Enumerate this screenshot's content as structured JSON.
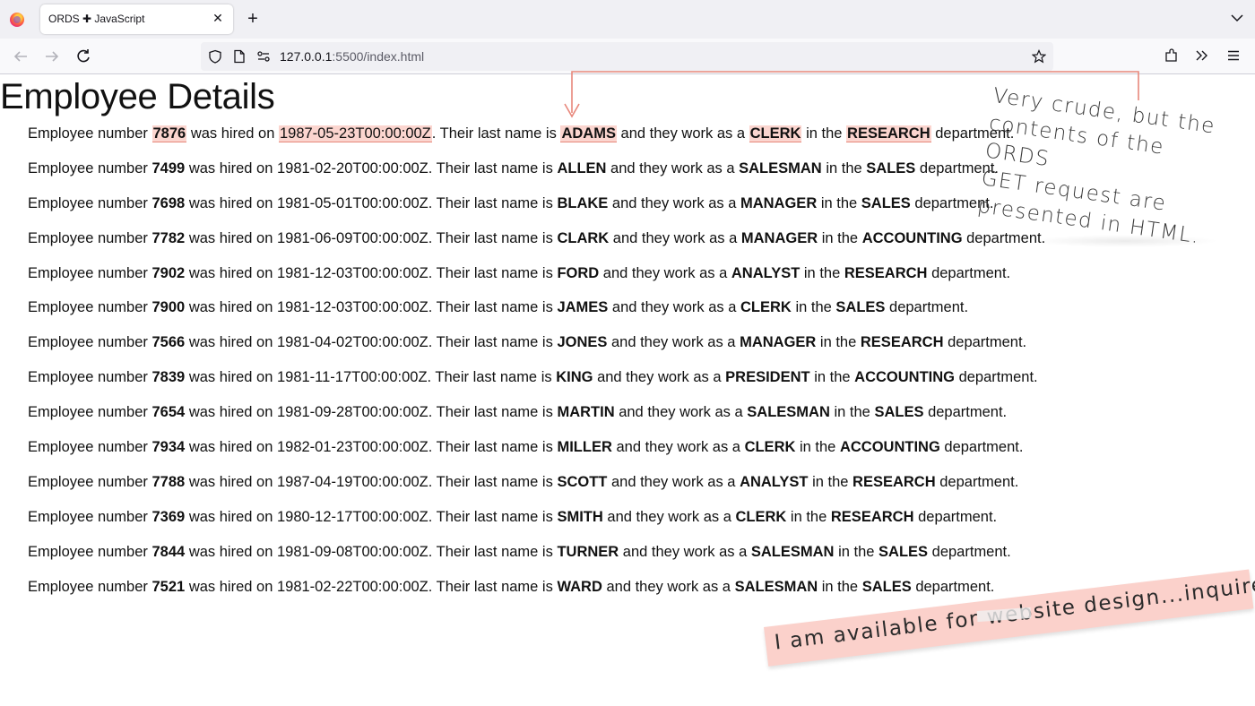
{
  "browser": {
    "tab": {
      "title": "ORDS ✚ JavaScript"
    },
    "url": {
      "host": "127.0.0.1",
      "path": ":5500/index.html"
    }
  },
  "colors": {
    "highlight": "#fbd5cf",
    "accent_line": "#e7867a",
    "sticky_note": "#fbd1cb"
  },
  "page": {
    "title": "Employee Details",
    "sentence": {
      "prefix": "Employee number",
      "hired": "was hired on",
      "lastname": ". Their last name is",
      "work": "and they work as a",
      "in_the": "in the",
      "suffix": "department."
    },
    "employees": [
      {
        "empno": "7876",
        "hiredate": "1987-05-23T00:00:00Z",
        "ename": "ADAMS",
        "job": "CLERK",
        "dept": "RESEARCH"
      },
      {
        "empno": "7499",
        "hiredate": "1981-02-20T00:00:00Z",
        "ename": "ALLEN",
        "job": "SALESMAN",
        "dept": "SALES"
      },
      {
        "empno": "7698",
        "hiredate": "1981-05-01T00:00:00Z",
        "ename": "BLAKE",
        "job": "MANAGER",
        "dept": "SALES"
      },
      {
        "empno": "7782",
        "hiredate": "1981-06-09T00:00:00Z",
        "ename": "CLARK",
        "job": "MANAGER",
        "dept": "ACCOUNTING"
      },
      {
        "empno": "7902",
        "hiredate": "1981-12-03T00:00:00Z",
        "ename": "FORD",
        "job": "ANALYST",
        "dept": "RESEARCH"
      },
      {
        "empno": "7900",
        "hiredate": "1981-12-03T00:00:00Z",
        "ename": "JAMES",
        "job": "CLERK",
        "dept": "SALES"
      },
      {
        "empno": "7566",
        "hiredate": "1981-04-02T00:00:00Z",
        "ename": "JONES",
        "job": "MANAGER",
        "dept": "RESEARCH"
      },
      {
        "empno": "7839",
        "hiredate": "1981-11-17T00:00:00Z",
        "ename": "KING",
        "job": "PRESIDENT",
        "dept": "ACCOUNTING"
      },
      {
        "empno": "7654",
        "hiredate": "1981-09-28T00:00:00Z",
        "ename": "MARTIN",
        "job": "SALESMAN",
        "dept": "SALES"
      },
      {
        "empno": "7934",
        "hiredate": "1982-01-23T00:00:00Z",
        "ename": "MILLER",
        "job": "CLERK",
        "dept": "ACCOUNTING"
      },
      {
        "empno": "7788",
        "hiredate": "1987-04-19T00:00:00Z",
        "ename": "SCOTT",
        "job": "ANALYST",
        "dept": "RESEARCH"
      },
      {
        "empno": "7369",
        "hiredate": "1980-12-17T00:00:00Z",
        "ename": "SMITH",
        "job": "CLERK",
        "dept": "RESEARCH"
      },
      {
        "empno": "7844",
        "hiredate": "1981-09-08T00:00:00Z",
        "ename": "TURNER",
        "job": "SALESMAN",
        "dept": "SALES"
      },
      {
        "empno": "7521",
        "hiredate": "1981-02-22T00:00:00Z",
        "ename": "WARD",
        "job": "SALESMAN",
        "dept": "SALES"
      }
    ]
  },
  "annotations": {
    "note": [
      "Very crude, but the",
      "contents of the ORDS",
      "GET request are",
      "presented in HTML."
    ],
    "sticky": "I am available for website design...inquire within."
  }
}
